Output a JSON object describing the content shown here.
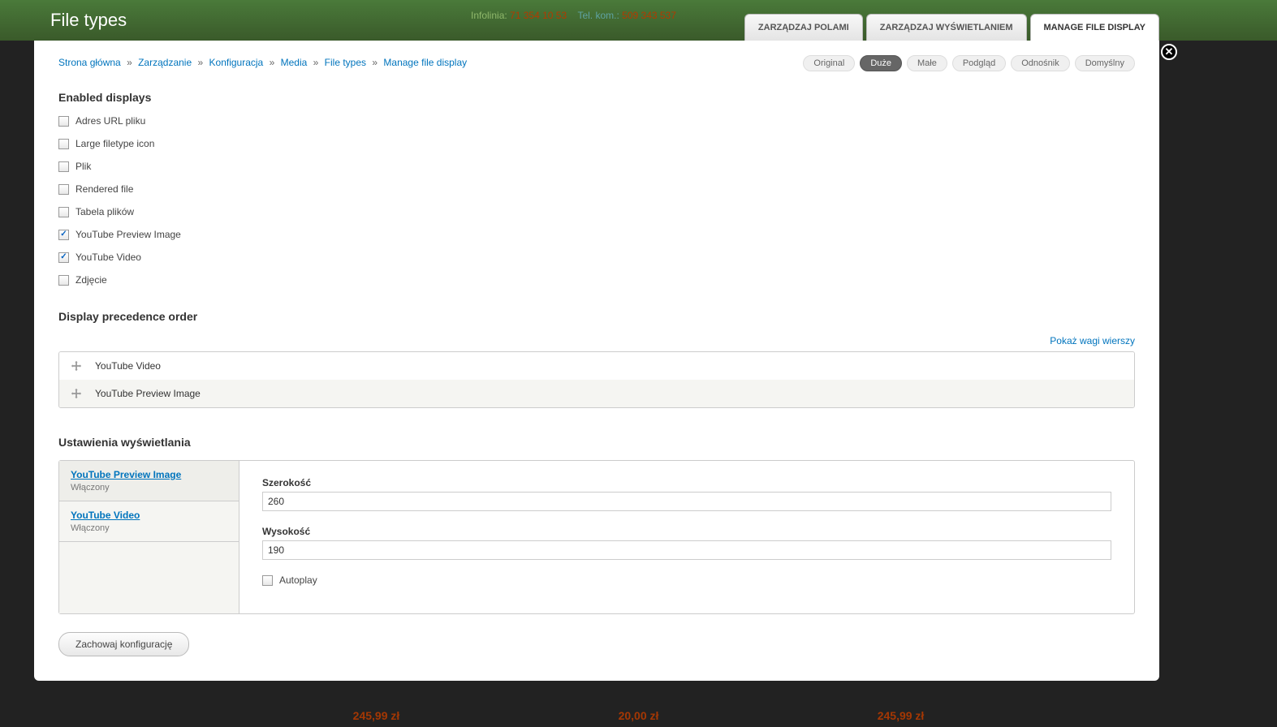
{
  "backdrop": {
    "info_label": "Infolinia:",
    "info_number": "71 354 10 53",
    "tel_label": "Tel. kom.:",
    "tel_number": "509 343 537"
  },
  "page_title": "File types",
  "primary_tabs": [
    {
      "label": "Zarządzaj polami",
      "active": false
    },
    {
      "label": "Zarządzaj wyświetlaniem",
      "active": false
    },
    {
      "label": "Manage file display",
      "active": true
    }
  ],
  "secondary_tabs": [
    {
      "label": "Original",
      "active": false
    },
    {
      "label": "Duże",
      "active": true
    },
    {
      "label": "Małe",
      "active": false
    },
    {
      "label": "Podgląd",
      "active": false
    },
    {
      "label": "Odnośnik",
      "active": false
    },
    {
      "label": "Domyślny",
      "active": false
    }
  ],
  "breadcrumb": {
    "items": [
      "Strona główna",
      "Zarządzanie",
      "Konfiguracja",
      "Media",
      "File types",
      "Manage file display"
    ],
    "sep": "»"
  },
  "enabled_displays": {
    "heading": "Enabled displays",
    "items": [
      {
        "label": "Adres URL pliku",
        "checked": false
      },
      {
        "label": "Large filetype icon",
        "checked": false
      },
      {
        "label": "Plik",
        "checked": false
      },
      {
        "label": "Rendered file",
        "checked": false
      },
      {
        "label": "Tabela plików",
        "checked": false
      },
      {
        "label": "YouTube Preview Image",
        "checked": true
      },
      {
        "label": "YouTube Video",
        "checked": true
      },
      {
        "label": "Zdjęcie",
        "checked": false
      }
    ]
  },
  "precedence": {
    "heading": "Display precedence order",
    "show_weights": "Pokaż wagi wierszy",
    "rows": [
      "YouTube Video",
      "YouTube Preview Image"
    ]
  },
  "display_settings": {
    "heading": "Ustawienia wyświetlania",
    "vtabs": [
      {
        "title": "YouTube Preview Image",
        "summary": "Włączony",
        "active": true
      },
      {
        "title": "YouTube Video",
        "summary": "Włączony",
        "active": false
      }
    ],
    "fields": {
      "width_label": "Szerokość",
      "width_value": "260",
      "height_label": "Wysokość",
      "height_value": "190",
      "autoplay_label": "Autoplay",
      "autoplay_checked": false
    }
  },
  "save_button": "Zachowaj konfigurację",
  "bg_prices": [
    "245,99 zł",
    "20,00 zł",
    "245,99 zł"
  ]
}
